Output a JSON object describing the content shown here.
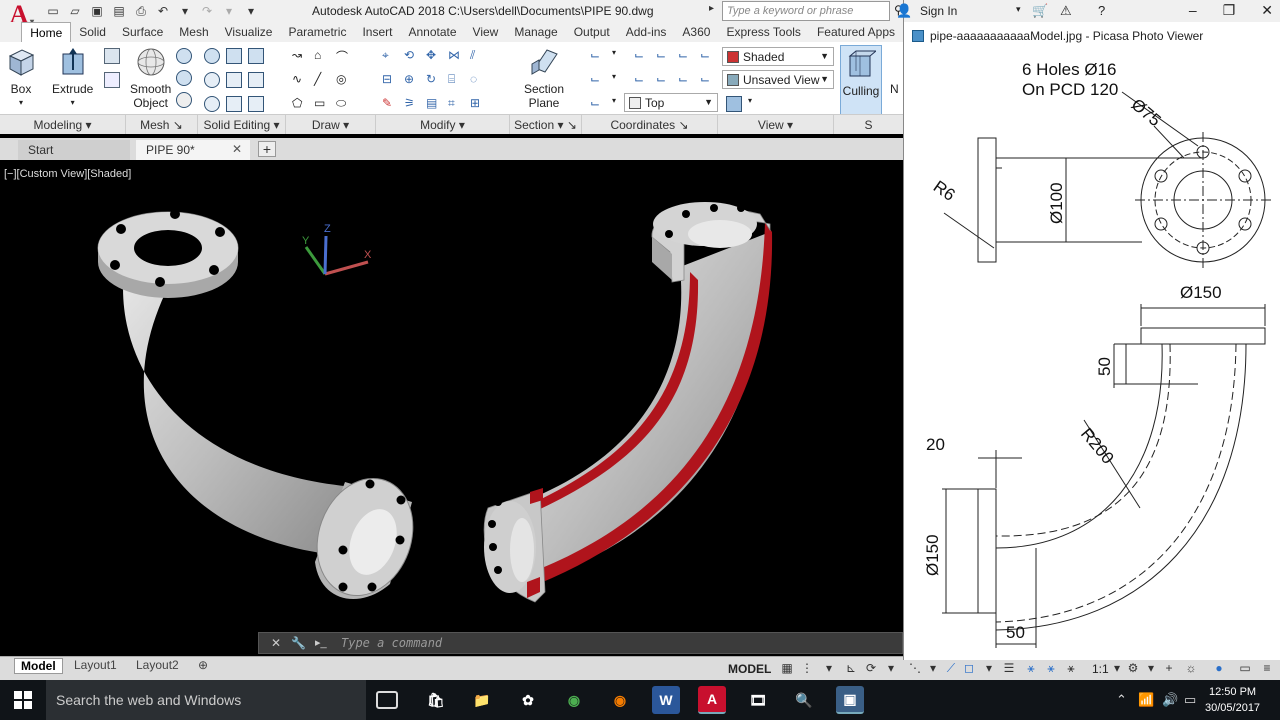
{
  "app": {
    "logo_letter": "A",
    "title": "Autodesk AutoCAD 2018    C:\\Users\\dell\\Documents\\PIPE 90.dwg",
    "search_placeholder": "Type a keyword or phrase",
    "sign_in": "Sign In"
  },
  "ribbon": {
    "tabs": [
      "Home",
      "Solid",
      "Surface",
      "Mesh",
      "Visualize",
      "Parametric",
      "Insert",
      "Annotate",
      "View",
      "Manage",
      "Output",
      "Add-ins",
      "A360",
      "Express Tools",
      "Featured Apps"
    ],
    "active_tab": "Home",
    "buttons": {
      "box": "Box",
      "extrude": "Extrude",
      "smooth_object_1": "Smooth",
      "smooth_object_2": "Object",
      "section_plane_1": "Section",
      "section_plane_2": "Plane",
      "culling": "Culling",
      "next_partial": "N"
    },
    "combos": {
      "visual_style": "Shaded",
      "view_state": "Unsaved View",
      "ucs": "Top"
    },
    "panels": [
      "Modeling",
      "Mesh",
      "Solid Editing",
      "Draw",
      "Modify",
      "Section",
      "Coordinates",
      "View",
      "S"
    ]
  },
  "file_tabs": {
    "start": "Start",
    "current": "PIPE 90*"
  },
  "viewport": {
    "label": "[−][Custom View][Shaded]",
    "axis_x": "X",
    "axis_y": "Y",
    "axis_z": "Z",
    "section_color": "#b0141c"
  },
  "command_line": {
    "placeholder": "Type a command"
  },
  "layout_tabs": [
    "Model",
    "Layout1",
    "Layout2"
  ],
  "status_bar": {
    "model": "MODEL",
    "scale": "1:1"
  },
  "picasa": {
    "title": "pipe-aaaaaaaaaaaModel.jpg - Picasa Photo Viewer",
    "drawing": {
      "holes_note_1": "6 Holes Ø16",
      "holes_note_2": "On PCD 120",
      "dia_75": "Ø75",
      "r6": "R6",
      "dia_100": "Ø100",
      "dia_150_top": "Ø150",
      "dim_50_vert": "50",
      "r200": "R200",
      "dim_20": "20",
      "dia_150_side": "Ø150",
      "dim_50_horiz": "50"
    }
  },
  "taskbar": {
    "search": "Search the web and Windows",
    "time": "12:50 PM",
    "date": "30/05/2017"
  }
}
